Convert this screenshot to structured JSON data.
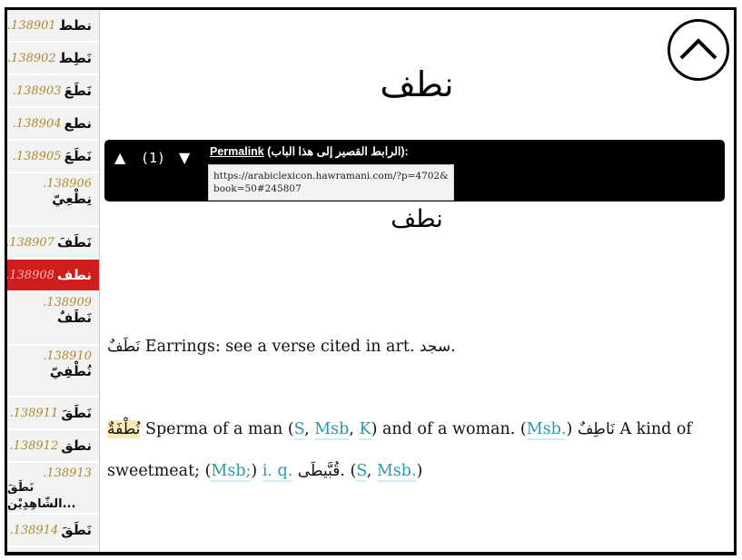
{
  "sidebar": {
    "items": [
      {
        "num": ".138901",
        "word": "نطط"
      },
      {
        "num": ".138902",
        "word": "نَطِط"
      },
      {
        "num": ".138903",
        "word": "نَطَعَ"
      },
      {
        "num": ".138904",
        "word": "نطع"
      },
      {
        "num": ".138905",
        "word": "نَطَعَ"
      },
      {
        "num": ".138906",
        "word": "نِطْعِيّ"
      },
      {
        "num": ".138907",
        "word": "نَطَفَ"
      },
      {
        "num": ".138908",
        "word": "نطف",
        "active": true
      },
      {
        "num": ".138909",
        "word": "نَطَفٌ"
      },
      {
        "num": ".138910",
        "word": "نُطْفِيّ"
      },
      {
        "num": ".138911",
        "word": "نَطَقَ"
      },
      {
        "num": ".138912",
        "word": "نطق"
      },
      {
        "num": ".138913",
        "word": "نَطَقَ الشّاهِدِيْن..."
      },
      {
        "num": ".138914",
        "word": "نَطَقَ"
      }
    ]
  },
  "main": {
    "title": "نطف",
    "up_icon": "chevron-up-icon",
    "nav": {
      "up_arrow": "▲",
      "count": "(1)",
      "down_arrow": "▼",
      "permalink_label": "Permalink",
      "permalink_arabic": "(الرابط القصير إلى هذا الباب):",
      "url": "https://arabiclexicon.hawramani.com/?p=4702&book=50#245807"
    },
    "subtitle": "نطف",
    "entry1": {
      "head": "نَطَفٌ",
      "text": " Earrings: see a verse cited in art. ",
      "ref": "سجد",
      "end": "."
    },
    "entry2": {
      "head": "نُطْفَةٌ",
      "t1": " Sperma of a man (",
      "s1": "S",
      "c1": ", ",
      "s2": "Msb",
      "c2": ", ",
      "s3": "K",
      "t2": ") and of a woman. (",
      "s4": "Msb.",
      "t3": ") ",
      "ar1": "نَاطِفٌ",
      "t4": " A kind of sweetmeat; (",
      "s5": "Msb;",
      "t5": ") ",
      "s6": "i. q.",
      "t6": " ",
      "ar2": "قُبَّيطَى",
      "t7": ". (",
      "s7": "S",
      "c3": ", ",
      "s8": "Msb.",
      "t8": ")"
    }
  },
  "colors": {
    "accent_active": "#cf1d1d",
    "number_gold": "#b08a2e",
    "source_teal": "#2a9aa8",
    "highlight": "#fde9b8"
  }
}
